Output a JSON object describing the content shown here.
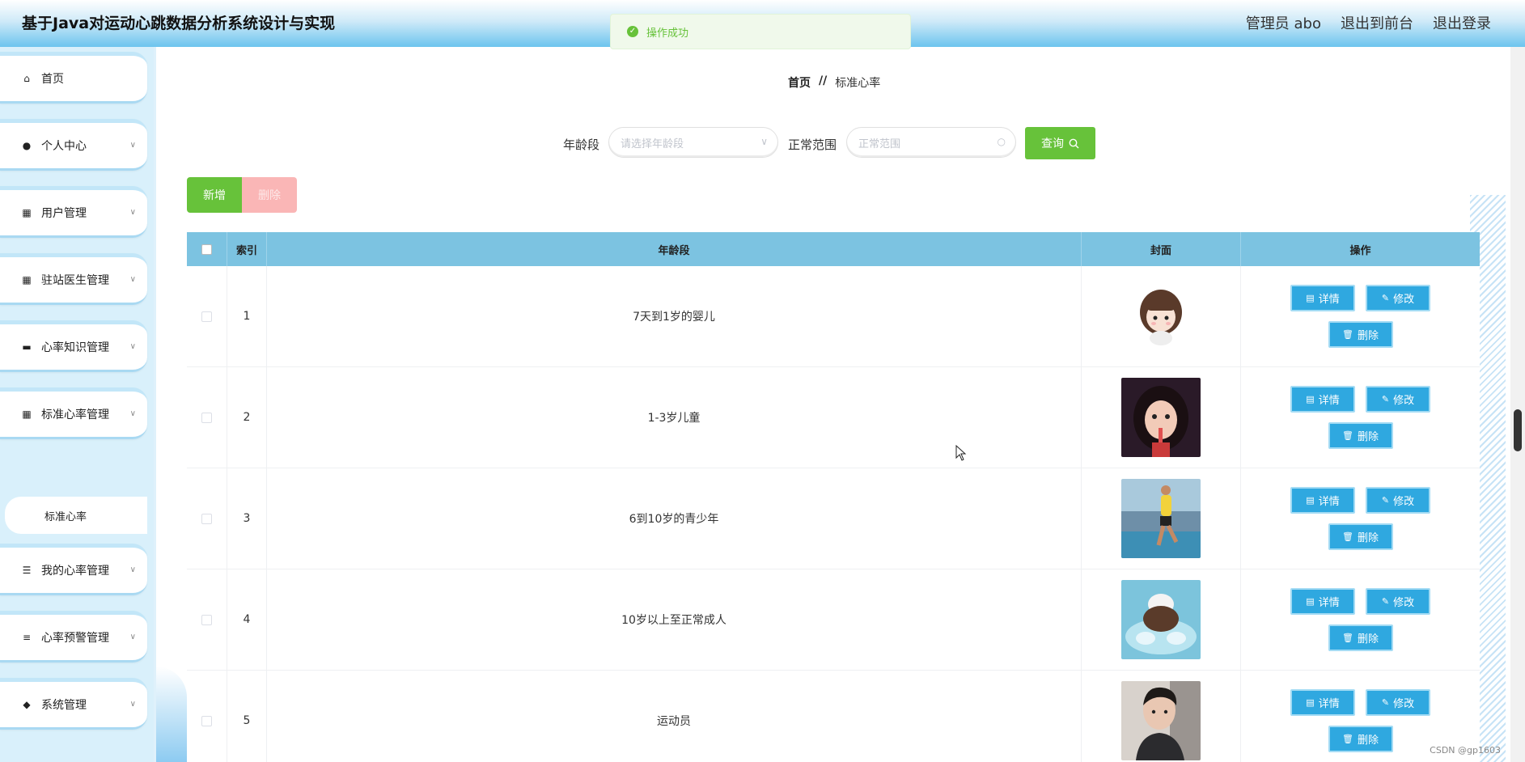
{
  "header": {
    "title": "基于Java对运动心跳数据分析系统设计与实现",
    "links": [
      "管理员 abo",
      "退出到前台",
      "退出登录"
    ]
  },
  "toast": {
    "text": "操作成功"
  },
  "sidebar": {
    "items": [
      {
        "label": "首页",
        "icon": "home-icon",
        "has_arrow": false
      },
      {
        "label": "个人中心",
        "icon": "user-icon",
        "has_arrow": true
      },
      {
        "label": "用户管理",
        "icon": "grid-icon",
        "has_arrow": true
      },
      {
        "label": "驻站医生管理",
        "icon": "grid-icon",
        "has_arrow": true
      },
      {
        "label": "心率知识管理",
        "icon": "monitor-icon",
        "has_arrow": true
      },
      {
        "label": "标准心率管理",
        "icon": "grid-icon",
        "has_arrow": true
      },
      {
        "label": "我的心率管理",
        "icon": "sliders-icon",
        "has_arrow": true
      },
      {
        "label": "心率预警管理",
        "icon": "list-icon",
        "has_arrow": true
      },
      {
        "label": "系统管理",
        "icon": "pin-icon",
        "has_arrow": true
      }
    ],
    "submenu": {
      "label": "标准心率"
    }
  },
  "breadcrumb": {
    "home": "首页",
    "sep": "//",
    "current": "标准心率"
  },
  "search": {
    "age_label": "年龄段",
    "age_placeholder": "请选择年龄段",
    "range_label": "正常范围",
    "range_placeholder": "正常范围",
    "query_label": "查询"
  },
  "toolbar": {
    "add_label": "新增",
    "delete_label": "删除"
  },
  "table": {
    "headers": {
      "index": "索引",
      "age": "年龄段",
      "cover": "封面",
      "ops": "操作"
    },
    "rows": [
      {
        "index": "1",
        "age": "7天到1岁的婴儿"
      },
      {
        "index": "2",
        "age": "1-3岁儿童"
      },
      {
        "index": "3",
        "age": "6到10岁的青少年"
      },
      {
        "index": "4",
        "age": "10岁以上至正常成人"
      },
      {
        "index": "5",
        "age": "运动员"
      }
    ],
    "op_labels": {
      "detail": "详情",
      "edit": "修改",
      "delete": "删除"
    }
  },
  "watermark": "CSDN @gp1603",
  "colors": {
    "accent": "#67c23a",
    "table_header": "#7cc3e1",
    "op_button": "#2fa8e0",
    "danger_light": "#fab6b6"
  }
}
